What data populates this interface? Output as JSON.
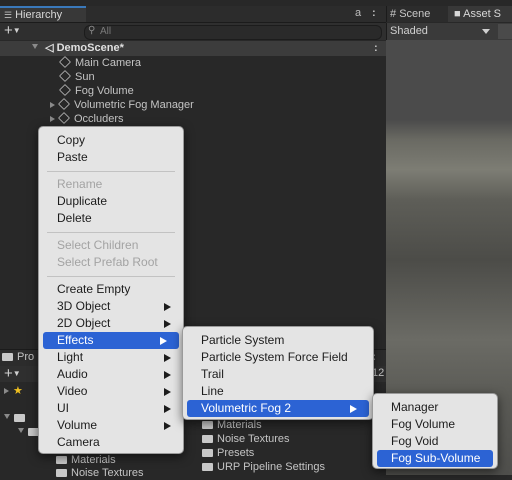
{
  "hierarchy": {
    "tab_title": "Hierarchy",
    "search_placeholder": "All",
    "scene_name": "DemoScene*",
    "items": [
      {
        "label": "Main Camera"
      },
      {
        "label": "Sun"
      },
      {
        "label": "Fog Volume"
      },
      {
        "label": "Volumetric Fog Manager"
      },
      {
        "label": "Occluders"
      }
    ],
    "lock_glyph": "a",
    "more_glyph": ":"
  },
  "scene_view": {
    "tab_scene": "Scene",
    "tab_asset_store": "Asset S",
    "shading_mode": "Shaded"
  },
  "project": {
    "tab_title": "Pro",
    "count": "12",
    "items": [
      {
        "label": "Materials"
      },
      {
        "label": "Noise Textures"
      },
      {
        "label": "Presets"
      },
      {
        "label": "URP Pipeline Settings"
      }
    ],
    "bottom_items": [
      {
        "label": "Materials"
      },
      {
        "label": "Noise Textures"
      }
    ]
  },
  "context_menu": {
    "items": [
      {
        "label": "Copy"
      },
      {
        "label": "Paste"
      },
      {
        "label": "Rename"
      },
      {
        "label": "Duplicate"
      },
      {
        "label": "Delete"
      },
      {
        "label": "Select Children"
      },
      {
        "label": "Select Prefab Root"
      },
      {
        "label": "Create Empty"
      },
      {
        "label": "3D Object"
      },
      {
        "label": "2D Object"
      },
      {
        "label": "Effects"
      },
      {
        "label": "Light"
      },
      {
        "label": "Audio"
      },
      {
        "label": "Video"
      },
      {
        "label": "UI"
      },
      {
        "label": "Volume"
      },
      {
        "label": "Camera"
      }
    ]
  },
  "effects_menu": {
    "items": [
      {
        "label": "Particle System"
      },
      {
        "label": "Particle System Force Field"
      },
      {
        "label": "Trail"
      },
      {
        "label": "Line"
      },
      {
        "label": "Volumetric Fog 2"
      }
    ]
  },
  "fog_menu": {
    "items": [
      {
        "label": "Manager"
      },
      {
        "label": "Fog Volume"
      },
      {
        "label": "Fog Void"
      },
      {
        "label": "Fog Sub-Volume"
      }
    ]
  },
  "colors": {
    "highlight": "#2c63d4",
    "menu_bg": "#e4e4e4",
    "panel_bg": "#282828",
    "tab_accent": "#3a79bb"
  }
}
